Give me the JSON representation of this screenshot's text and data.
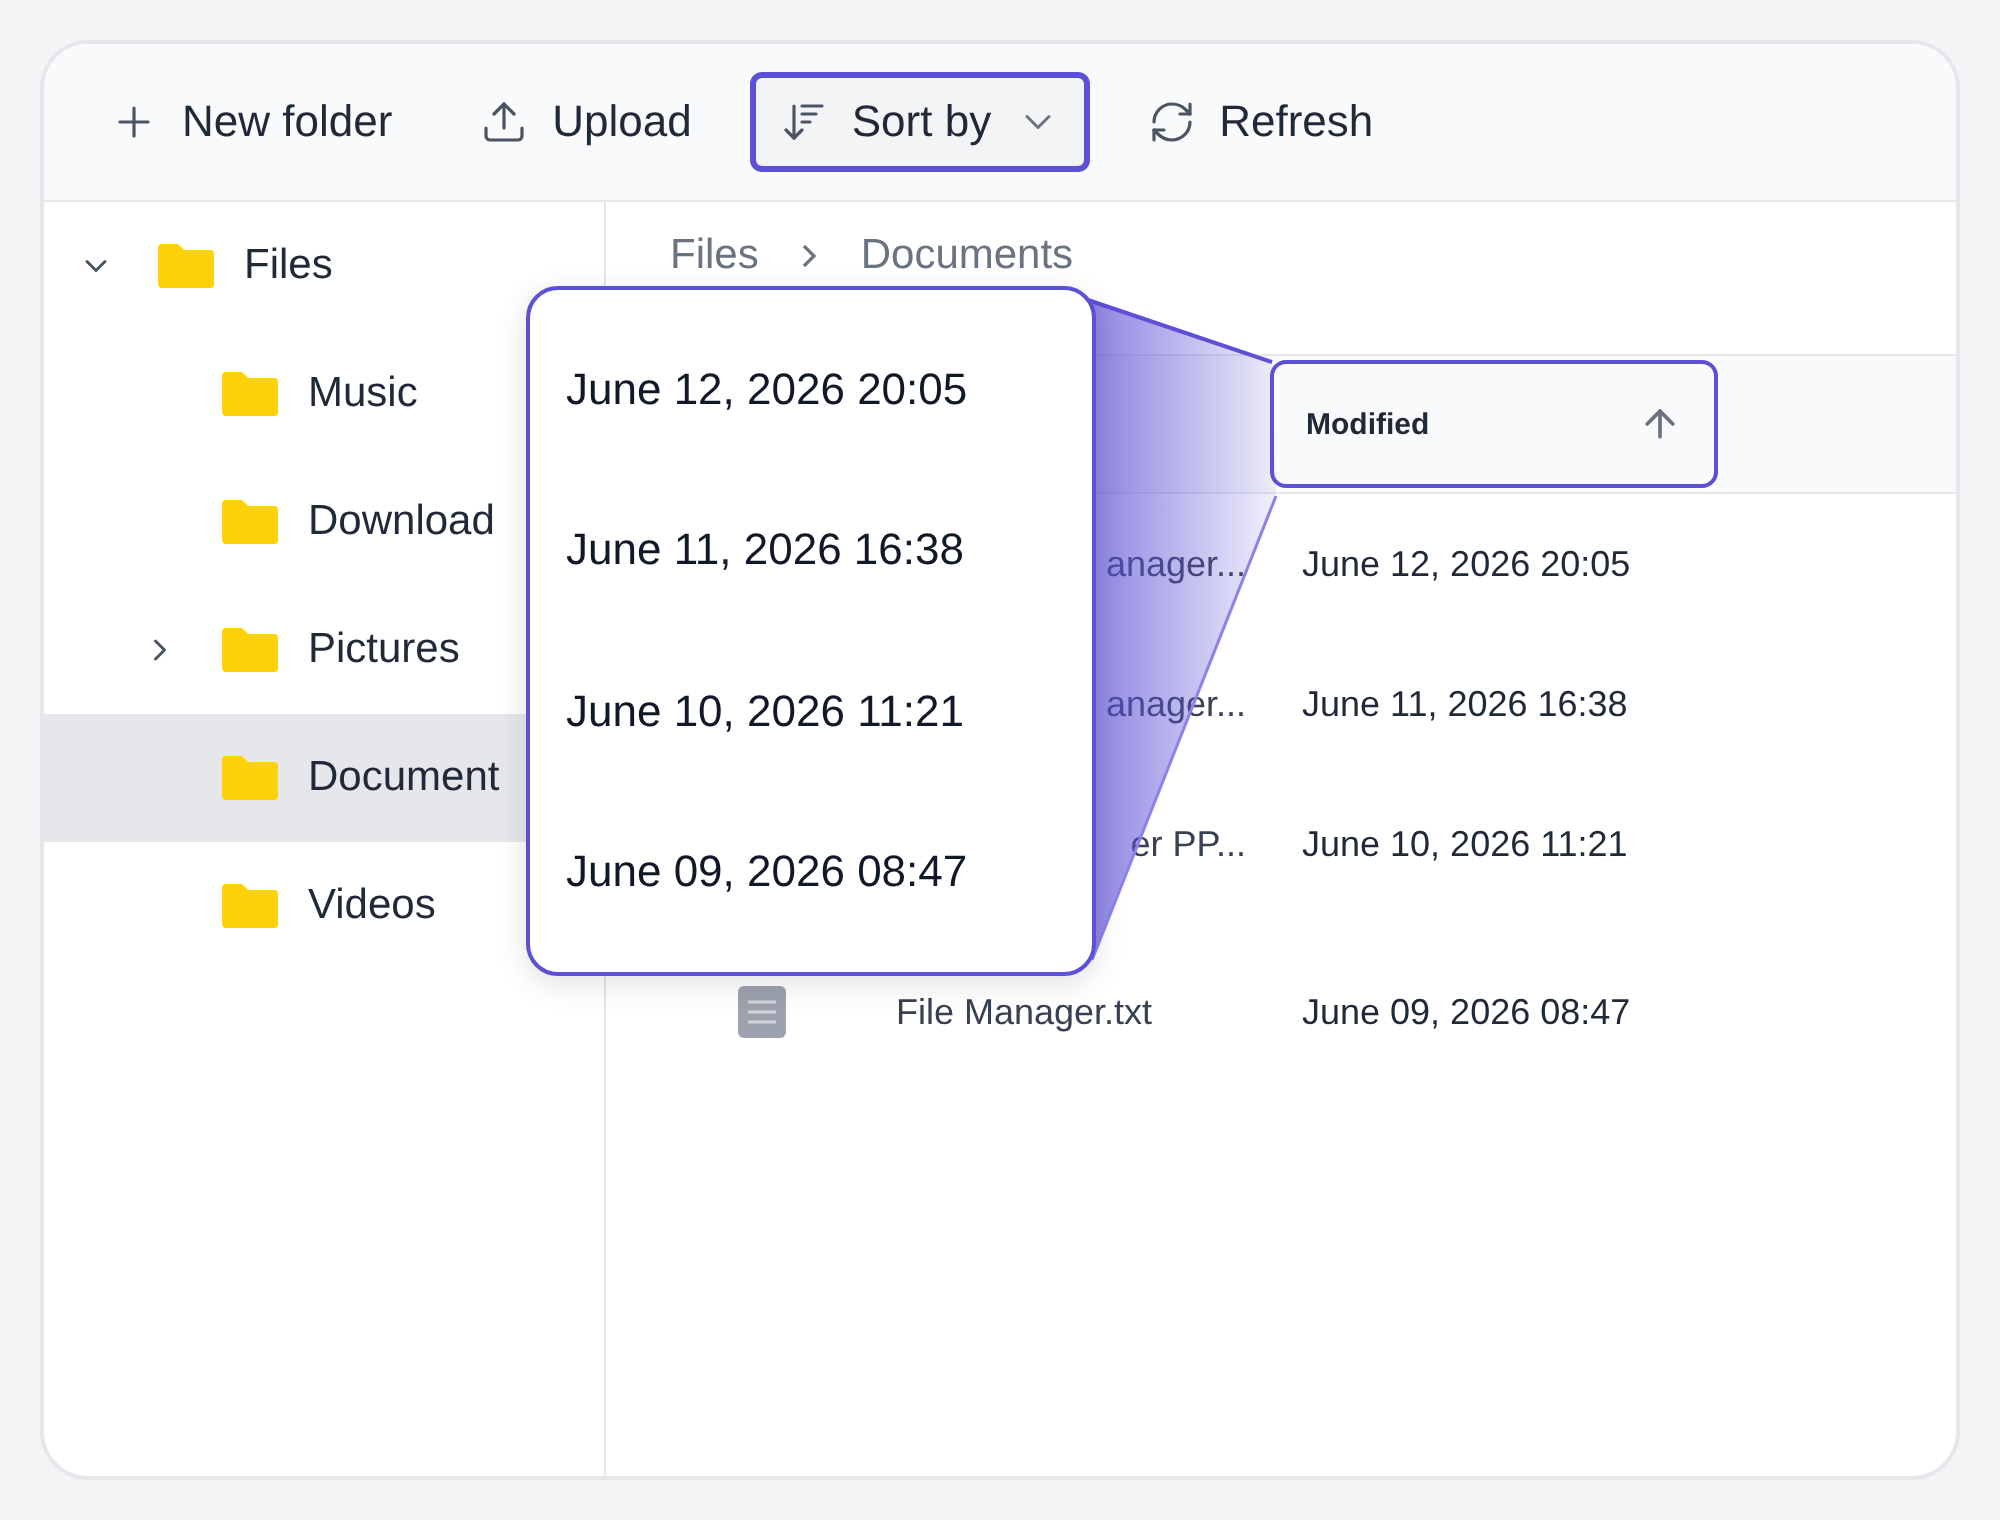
{
  "toolbar": [
    {
      "kind": "add",
      "label": "New folder",
      "selected": false
    },
    {
      "kind": "upload",
      "label": "Upload",
      "selected": false
    },
    {
      "kind": "sort",
      "label": "Sort by",
      "selected": true
    },
    {
      "kind": "refresh",
      "label": "Refresh",
      "selected": false
    }
  ],
  "sidebar": {
    "tree": [
      {
        "label": "Files",
        "expanded": true,
        "selected": false,
        "children": [
          {
            "label": "Music",
            "selected": false
          },
          {
            "label": "Download",
            "selected": false
          },
          {
            "label": "Pictures",
            "expanded": false,
            "selected": false
          },
          {
            "label": "Document",
            "selected": true
          },
          {
            "label": "Videos",
            "selected": false
          }
        ]
      }
    ]
  },
  "breadcrumb": [
    "Files",
    "Documents"
  ],
  "table": {
    "columns": [
      {
        "label": "Modified",
        "ascending": true,
        "selected": true
      }
    ],
    "rows": [
      {
        "kind": "covered",
        "name": "anager...",
        "modified": "June 12, 2026 20:05"
      },
      {
        "kind": "covered",
        "name": "anager...",
        "modified": "June 11, 2026 16:38"
      },
      {
        "kind": "covered",
        "name": "er PP...",
        "modified": "June 10, 2026 11:21"
      },
      {
        "kind": "file",
        "name": "File Manager.txt",
        "modified": "June 09, 2026 08:47"
      }
    ]
  },
  "magnifier": {
    "entries": [
      "June 12, 2026 20:05",
      "June 11, 2026 16:38",
      "June 10, 2026 11:21",
      "June 09, 2026 08:47"
    ]
  }
}
